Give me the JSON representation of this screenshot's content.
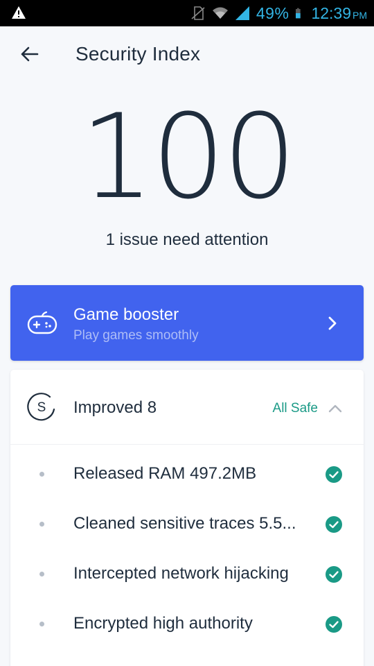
{
  "statusbar": {
    "battery_text": "49%",
    "time": "12:39",
    "ampm": "PM",
    "icons": [
      "warning-icon",
      "no-sim-icon",
      "wifi-icon",
      "signal-icon",
      "battery-icon"
    ]
  },
  "header": {
    "title": "Security Index",
    "back_icon": "arrow-left-icon"
  },
  "score": {
    "value": "100",
    "subtitle": "1 issue need attention"
  },
  "booster": {
    "title": "Game booster",
    "subtitle": "Play games smoothly",
    "icon": "gamepad-icon",
    "color": "#4163ee"
  },
  "improved": {
    "title": "Improved 8",
    "status": "All Safe",
    "status_color": "#1a9a86",
    "items": [
      {
        "label": "Released RAM 497.2MB"
      },
      {
        "label": "Cleaned sensitive traces 5.5..."
      },
      {
        "label": "Intercepted network hijacking"
      },
      {
        "label": "Encrypted high authority"
      }
    ]
  },
  "colors": {
    "accent": "#4163ee",
    "check": "#1a9a86",
    "text": "#1f2d3d"
  }
}
